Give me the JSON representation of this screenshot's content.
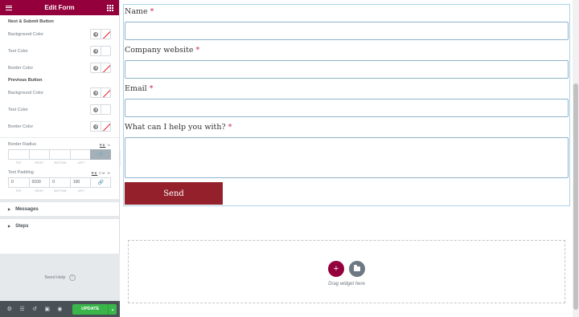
{
  "header": {
    "title": "Edit Form"
  },
  "style_sections": [
    {
      "title": "Next & Submit Button",
      "rows": [
        {
          "label": "Background Color",
          "swatch": "none"
        },
        {
          "label": "Text Color",
          "swatch": "white"
        },
        {
          "label": "Border Color",
          "swatch": "none"
        }
      ]
    },
    {
      "title": "Previous Button",
      "rows": [
        {
          "label": "Background Color",
          "swatch": "none"
        },
        {
          "label": "Text Color",
          "swatch": "white"
        },
        {
          "label": "Border Color",
          "swatch": "none"
        }
      ]
    }
  ],
  "border_radius": {
    "label": "Border Radius",
    "unit": "PX",
    "unit_extra": "%",
    "values": [
      "",
      "",
      "",
      ""
    ],
    "sides": [
      "TOP",
      "RIGHT",
      "BOTTOM",
      "LEFT"
    ]
  },
  "text_padding": {
    "label": "Text Padding",
    "unit": "PX",
    "unit_extra1": "EM",
    "unit_extra2": "%",
    "values": [
      "0",
      "0100",
      "0",
      "100"
    ],
    "sides": [
      "TOP",
      "RIGHT",
      "BOTTOM",
      "LEFT"
    ]
  },
  "accordions": [
    "Messages",
    "Steps"
  ],
  "help": {
    "label": "Need Help",
    "q": "?"
  },
  "footer": {
    "update_label": "UPDATE"
  },
  "form": {
    "fields": [
      {
        "label": "Name",
        "required": "*"
      },
      {
        "label": "Company website",
        "required": "*"
      },
      {
        "label": "Email",
        "required": "*"
      },
      {
        "label": "What can I help you with?",
        "required": "*"
      }
    ],
    "submit_label": "Send"
  },
  "dropzone": {
    "add": "+",
    "text": "Drag widget here"
  },
  "colors": {
    "brand": "#93003c",
    "update": "#39b54a",
    "send": "#93202a"
  }
}
